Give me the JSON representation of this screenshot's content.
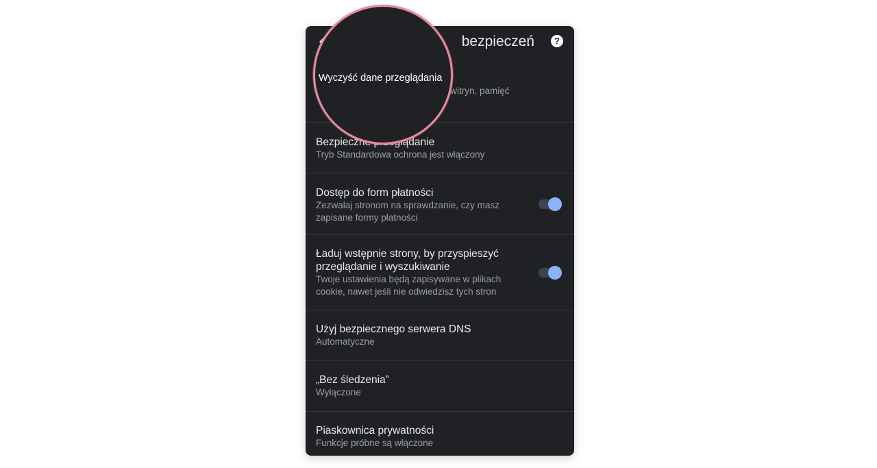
{
  "header": {
    "title": "bezpieczeń",
    "title_ellipsis": "...",
    "back_icon": "arrow-back-icon",
    "help_icon": "help-icon",
    "help_glyph": "?"
  },
  "settings": [
    {
      "id": "clear",
      "label": "Wyczyść dane przeglądania",
      "desc": "ane witryn, pamięć",
      "toggle": null
    },
    {
      "id": "safe",
      "label": "Bezpieczne przeglądanie",
      "desc": "Tryb Standardowa ochrona jest włączony",
      "toggle": null
    },
    {
      "id": "payment",
      "label": "Dostęp do form płatności",
      "desc": "Zezwalaj stronom na sprawdzanie, czy masz zapisane formy płatności",
      "toggle": true
    },
    {
      "id": "preload",
      "label": "Ładuj wstępnie strony, by przyspieszyć przeglądanie i wyszukiwanie",
      "desc": "Twoje ustawienia będą zapisywane w plikach cookie, nawet jeśli nie odwiedzisz tych stron",
      "toggle": true
    },
    {
      "id": "dns",
      "label": "Użyj bezpiecznego serwera DNS",
      "desc": "Automatyczne",
      "toggle": null
    },
    {
      "id": "dnt",
      "label": "„Bez śledzenia”",
      "desc": "Wyłączone",
      "toggle": null
    },
    {
      "id": "sandbox",
      "label": "Piaskownica prywatności",
      "desc": "Funkcje próbne są włączone",
      "toggle": null
    }
  ],
  "magnifier": {
    "label": "Wyczyść dane przeglądania",
    "ring_color": "#e8899f"
  },
  "colors": {
    "background": "#202124",
    "text_primary": "#e8eaed",
    "text_secondary": "#9aa0a6",
    "toggle_on": "#8ab4f8"
  }
}
